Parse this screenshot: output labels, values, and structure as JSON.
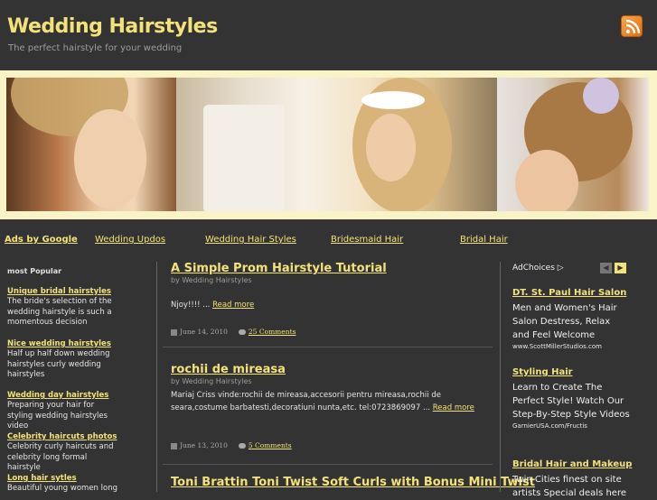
{
  "header": {
    "title": "Wedding Hairstyles",
    "tagline": "The perfect hairstyle for your wedding"
  },
  "colors": {
    "background": "#333333",
    "accent": "#f3e27a",
    "banner_frame": "#fbf3c8"
  },
  "nav": {
    "ads_label": "Ads by Google",
    "links": [
      "Wedding Updos",
      "Wedding Hair Styles",
      "Bridesmaid Hair",
      "Bridal Hair"
    ]
  },
  "sidebar_left": {
    "title": "most Popular",
    "items": [
      {
        "title": "Unique bridal hairstyles",
        "desc": "The bride's selection of the wedding hairstyle is such a momentous decision"
      },
      {
        "title": "Nice wedding hairstyles",
        "desc": "Half up half down wedding hairstyles curly wedding hairstyles"
      },
      {
        "title": "Wedding day hairstyles",
        "desc": "Preparing your hair for styling wedding hairstyles video"
      },
      {
        "title": "Celebrity haircuts photos",
        "desc": "Celebrity curly haircuts and celebrity long formal hairstyle"
      },
      {
        "title": "Long hair sytles",
        "desc": "Beautiful young women long"
      }
    ]
  },
  "posts": [
    {
      "title": "A Simple Prom Hairstyle Tutorial",
      "byline": "by Wedding Hairstyles",
      "body": "Njoy!!!! ...",
      "read_more": "Read more",
      "date": "June 14, 2010",
      "comments": "25 Comments"
    },
    {
      "title": "rochii de mireasa",
      "byline": "by Wedding Hairstyles",
      "body": "Mariaj Criss vinde:rochii de mireasa,accesorii pentru mireasa,rochii de seara,costume barbatesti,decoratiuni nunta,etc. tel:0723869097 ...",
      "read_more": "Read more",
      "date": "June 13, 2010",
      "comments": "5 Comments"
    },
    {
      "title": "Toni Brattin Toni Twist Soft Curls with Bonus Mini Twist"
    }
  ],
  "sidebar_right": {
    "adchoices": "AdChoices ▷",
    "ads": [
      {
        "title": "DT. St. Paul Hair Salon",
        "text": "Men and Women's Hair Salon Destress, Relax and Feel Welcome",
        "url": "www.ScottMillerStudios.com"
      },
      {
        "title": "Styling Hair",
        "text": "Learn to Create The Perfect Style! Watch Our Step-By-Step Style Videos",
        "url": "GarnierUSA.com/Fructis"
      },
      {
        "title": "Bridal Hair and Makeup",
        "text": "Twin Cities finest on site artists Special deals here"
      }
    ]
  }
}
